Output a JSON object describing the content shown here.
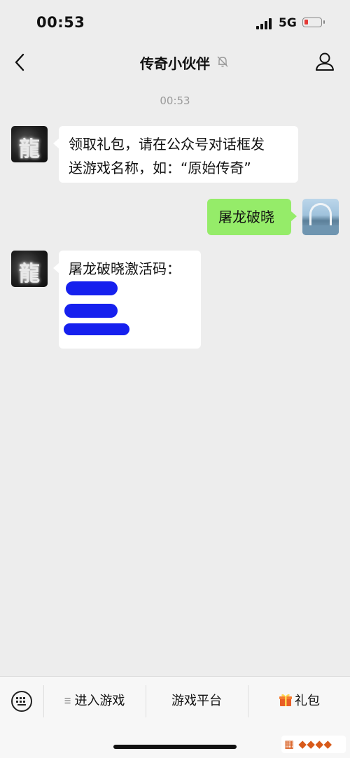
{
  "status_bar": {
    "time": "00:53",
    "network": "5G",
    "battery_color": "#e53935"
  },
  "nav": {
    "back_icon": "chevron-left-icon",
    "title": "传奇小伙伴",
    "mute_icon": "bell-muted-icon",
    "profile_icon": "person-icon"
  },
  "chat": {
    "timestamp": "00:53",
    "messages": [
      {
        "side": "left",
        "sender_avatar": "game-dragon-avatar",
        "lines": [
          "领取礼包，请在公众号对话框发",
          "送游戏名称，如：“原始传奇”"
        ]
      },
      {
        "side": "right",
        "sender_avatar": "user-bridge-avatar",
        "lines": [
          "屠龙破晓"
        ]
      },
      {
        "side": "left",
        "sender_avatar": "game-dragon-avatar",
        "lines": [
          "屠龙破晓激活码："
        ],
        "redacted_codes": 3
      }
    ]
  },
  "bottom_menu": {
    "keyboard_icon": "keyboard-icon",
    "items": [
      {
        "label": "进入游戏",
        "icon": "menu-lines-icon"
      },
      {
        "label": "游戏平台"
      },
      {
        "label": "礼包",
        "icon": "gift-icon"
      }
    ]
  },
  "colors": {
    "background": "#ededed",
    "incoming_bubble": "#ffffff",
    "outgoing_bubble": "#95ec69",
    "redaction": "#1620ee"
  }
}
